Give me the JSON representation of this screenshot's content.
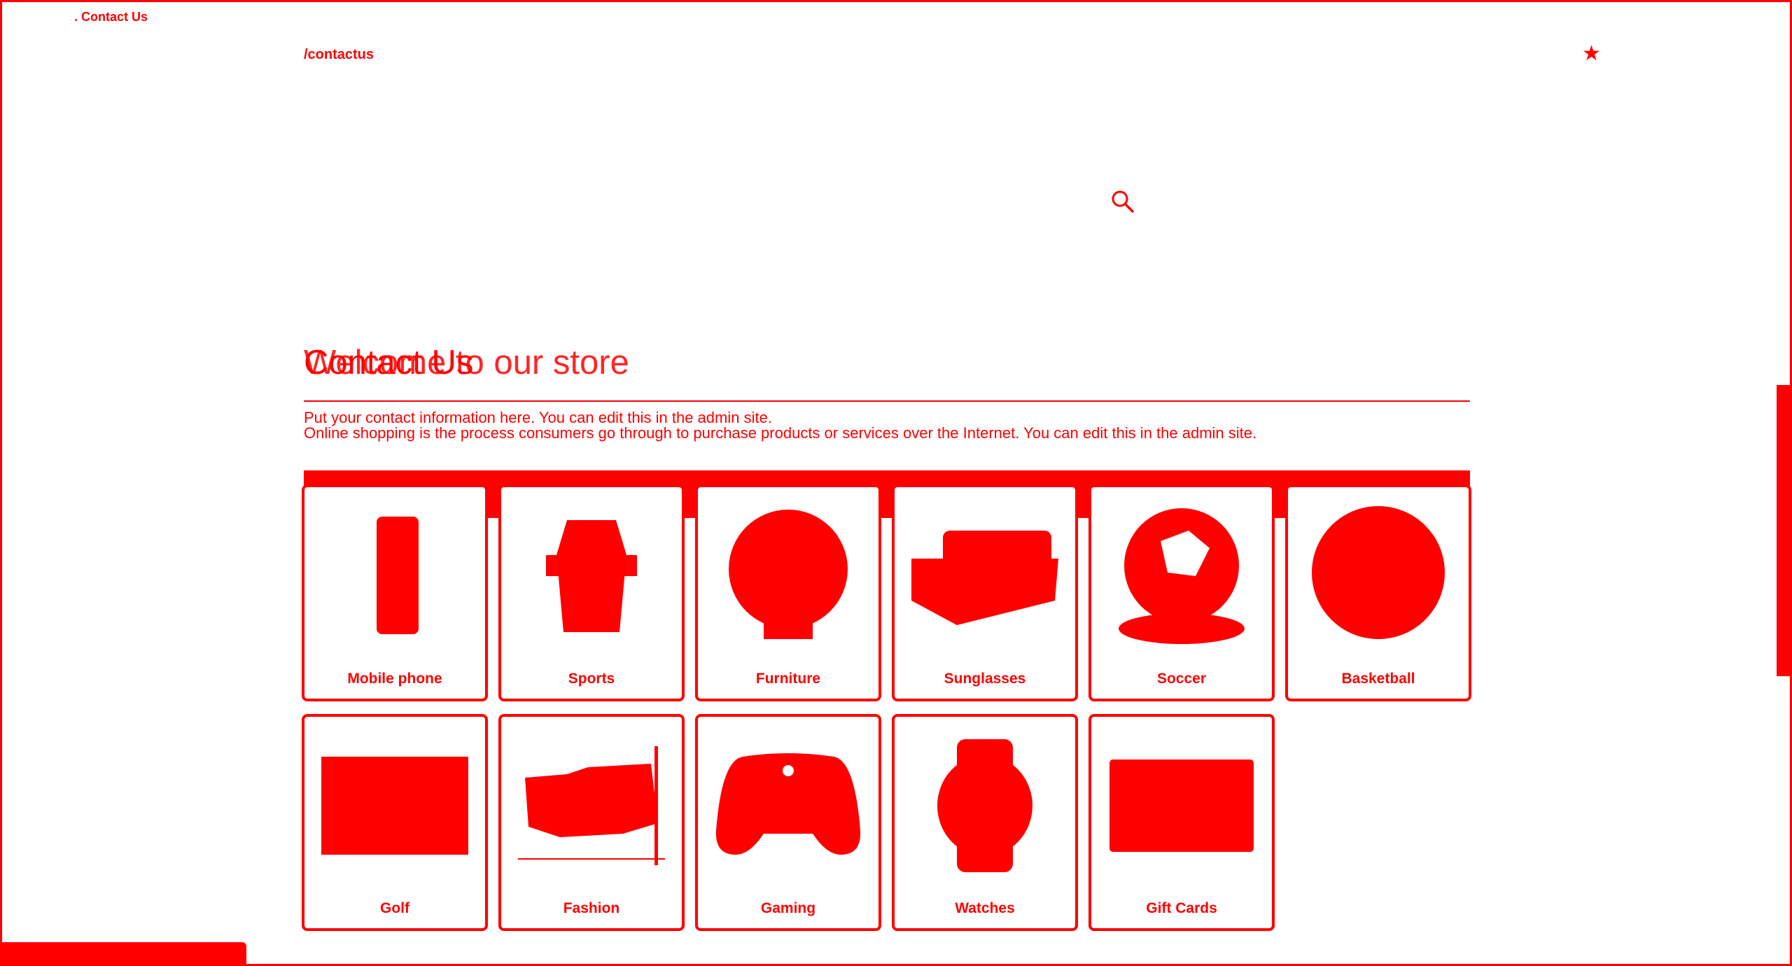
{
  "browser": {
    "tab_title": ". Contact Us",
    "url": "/contactus",
    "bookmark_icon": "star-icon"
  },
  "header": {
    "search_icon": "search-icon"
  },
  "page": {
    "title_contact": "Contact Us",
    "title_welcome": "Welcome to our store",
    "contact_text": "Put your contact information here. You can edit this in the admin site.",
    "welcome_text": "Online shopping is the process consumers go through to purchase products or services over the Internet. You can edit this in the admin site."
  },
  "categories": [
    {
      "label": "Mobile phone",
      "icon": "mobile-phone-icon"
    },
    {
      "label": "Sports",
      "icon": "sports-icon"
    },
    {
      "label": "Furniture",
      "icon": "furniture-icon"
    },
    {
      "label": "Sunglasses",
      "icon": "sunglasses-icon"
    },
    {
      "label": "Soccer",
      "icon": "soccer-ball-icon"
    },
    {
      "label": "Basketball",
      "icon": "basketball-icon"
    },
    {
      "label": "Golf",
      "icon": "golf-icon"
    },
    {
      "label": "Fashion",
      "icon": "fashion-icon"
    },
    {
      "label": "Gaming",
      "icon": "gamepad-icon"
    },
    {
      "label": "Watches",
      "icon": "watch-icon"
    },
    {
      "label": "Gift Cards",
      "icon": "gift-card-icon"
    }
  ],
  "colors": {
    "accent": "#ff0000",
    "background": "#ffffff"
  }
}
